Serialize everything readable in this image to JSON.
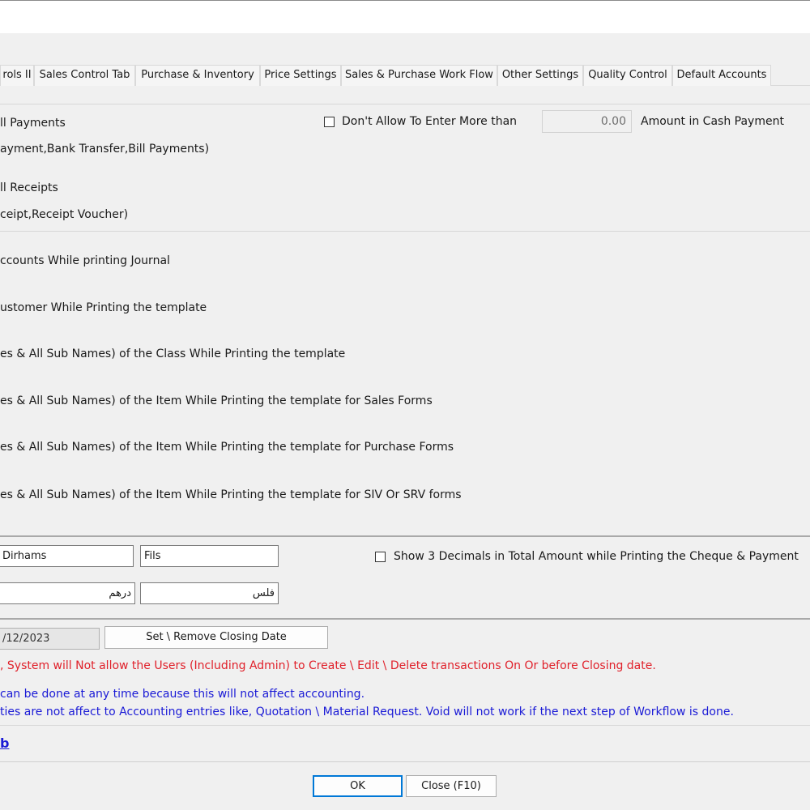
{
  "tabs": [
    "rols II",
    "Sales Control Tab",
    "Purchase & Inventory",
    "Price Settings",
    "Sales & Purchase Work Flow",
    "Other Settings",
    "Quality Control",
    "Default Accounts"
  ],
  "payments": {
    "line1": "ll Payments",
    "line2": "ayment,Bank Transfer,Bill Payments)",
    "cash_limit_label": "Don't Allow To Enter More than",
    "cash_limit_value": "0.00",
    "cash_limit_suffix": "Amount in Cash Payment"
  },
  "receipts": {
    "line1": "ll Receipts",
    "line2": "ceipt,Receipt Voucher)"
  },
  "printing": {
    "opt1": "ccounts While printing Journal",
    "opt2": "ustomer While Printing the template",
    "opt3": "es & All Sub Names) of the Class While Printing the template",
    "opt4": "es & All Sub Names) of the Item While Printing the template for Sales Forms",
    "opt5": "es & All Sub Names) of the Item While Printing the template for Purchase Forms",
    "opt6": "es & All Sub Names) of the Item While Printing the template for SIV Or SRV forms"
  },
  "currency": {
    "main_en": "Dirhams",
    "sub_en": "Fils",
    "main_ar": "درهم",
    "sub_ar": "فلس",
    "decimals_label": "Show 3 Decimals in Total Amount while Printing the Cheque & Payment"
  },
  "closing": {
    "date": "/12/2023",
    "set_remove_label": "Set \\ Remove Closing Date",
    "warning": ", System will Not allow the Users (Including Admin)  to Create \\ Edit \\ Delete transactions On Or before Closing date.",
    "info1": " can be done at any time because this will not affect accounting.",
    "info2": "ties are not affect to Accounting entries like, Quotation \\ Material Request. Void will not work if the next step of Workflow is done.",
    "link": "b"
  },
  "footer": {
    "ok_label": "OK",
    "close_label": "Close (F10)"
  },
  "colors": {
    "warning": "#e0202a",
    "info": "#1a1ad6",
    "default_button_border": "#0078d7"
  }
}
